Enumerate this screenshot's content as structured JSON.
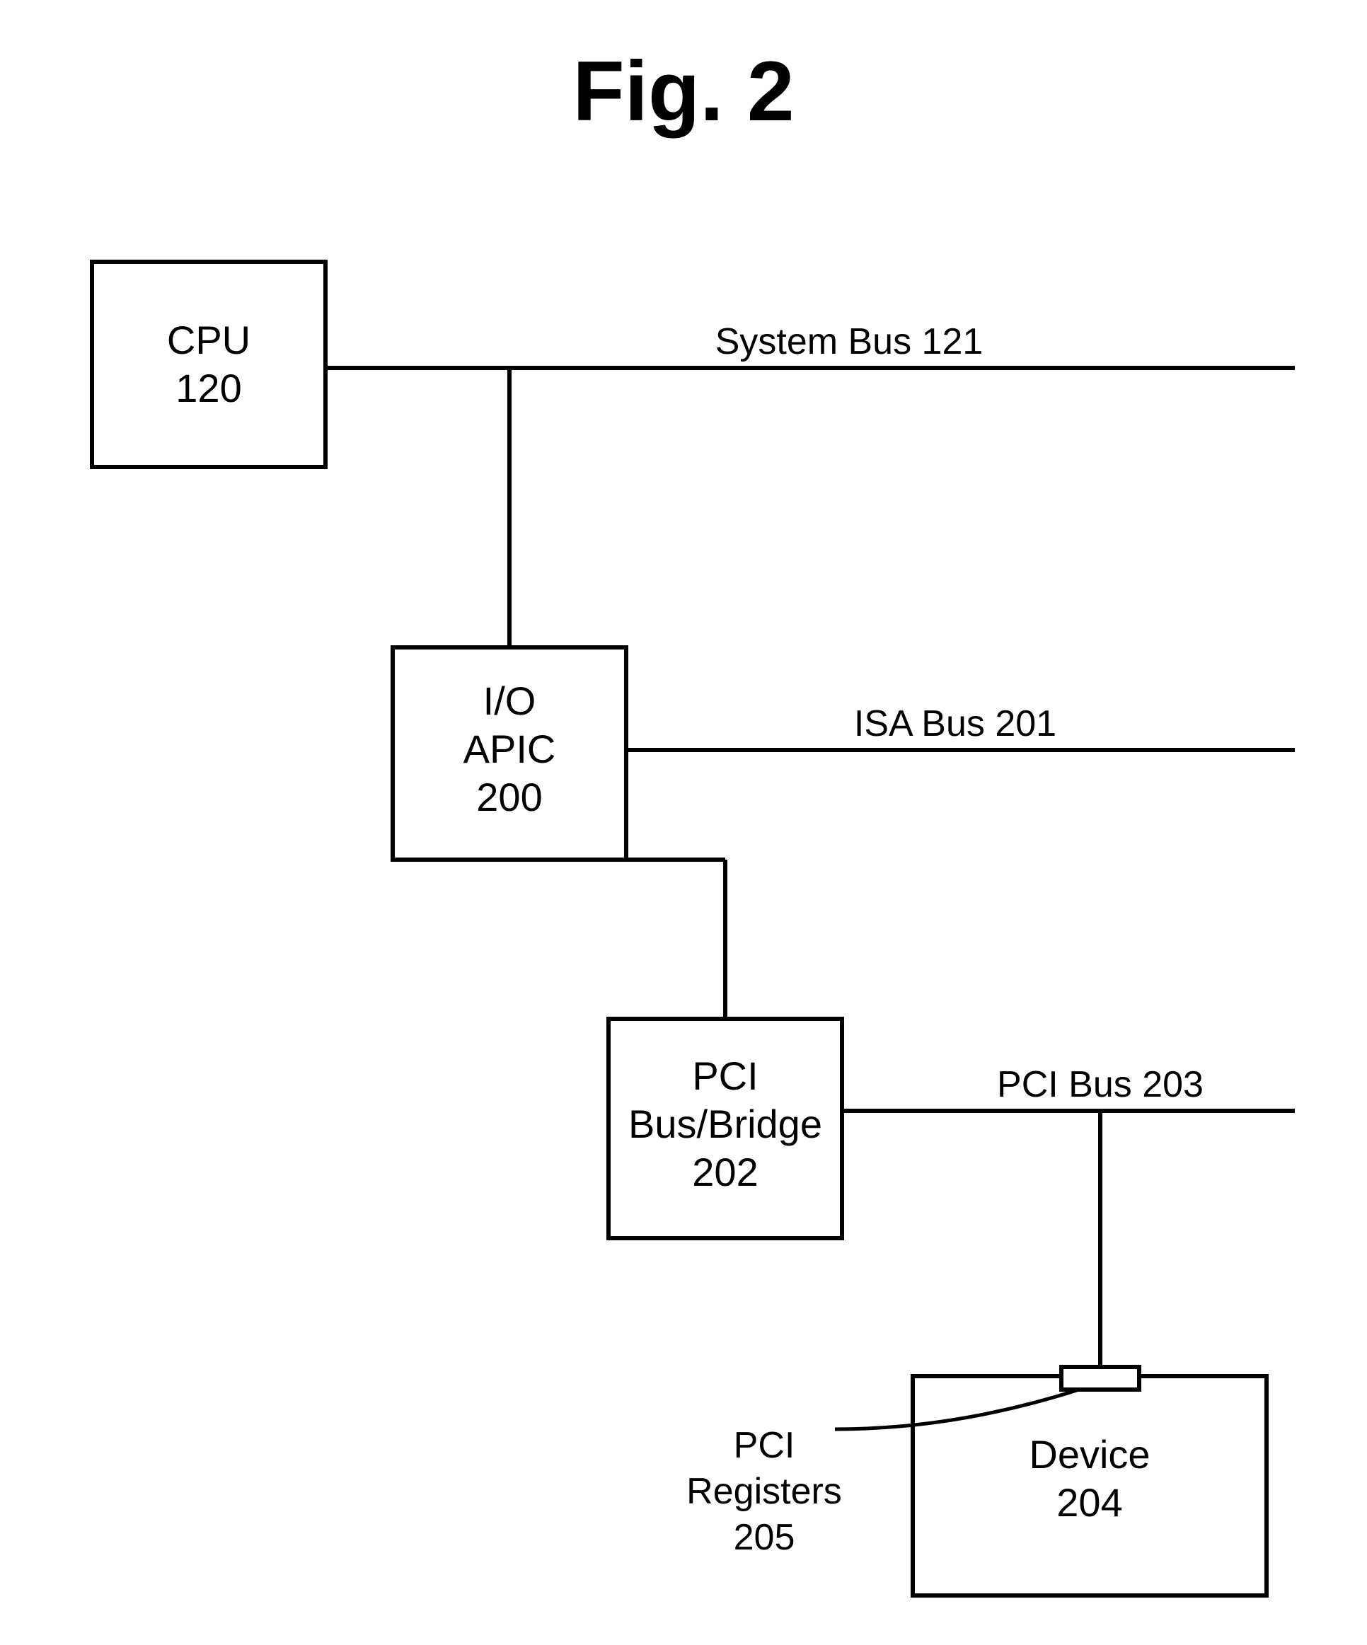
{
  "figure": {
    "title": "Fig. 2",
    "blocks": {
      "cpu": {
        "line1": "CPU",
        "line2": "120"
      },
      "ioapic": {
        "line1": "I/O",
        "line2": "APIC",
        "line3": "200"
      },
      "pcibridge": {
        "line1": "PCI",
        "line2": "Bus/Bridge",
        "line3": "202"
      },
      "device": {
        "line1": "Device",
        "line2": "204"
      }
    },
    "buses": {
      "system": "System Bus 121",
      "isa": "ISA Bus 201",
      "pci": "PCI Bus 203"
    },
    "annotations": {
      "pciregs": {
        "line1": "PCI",
        "line2": "Registers",
        "line3": "205"
      }
    }
  }
}
